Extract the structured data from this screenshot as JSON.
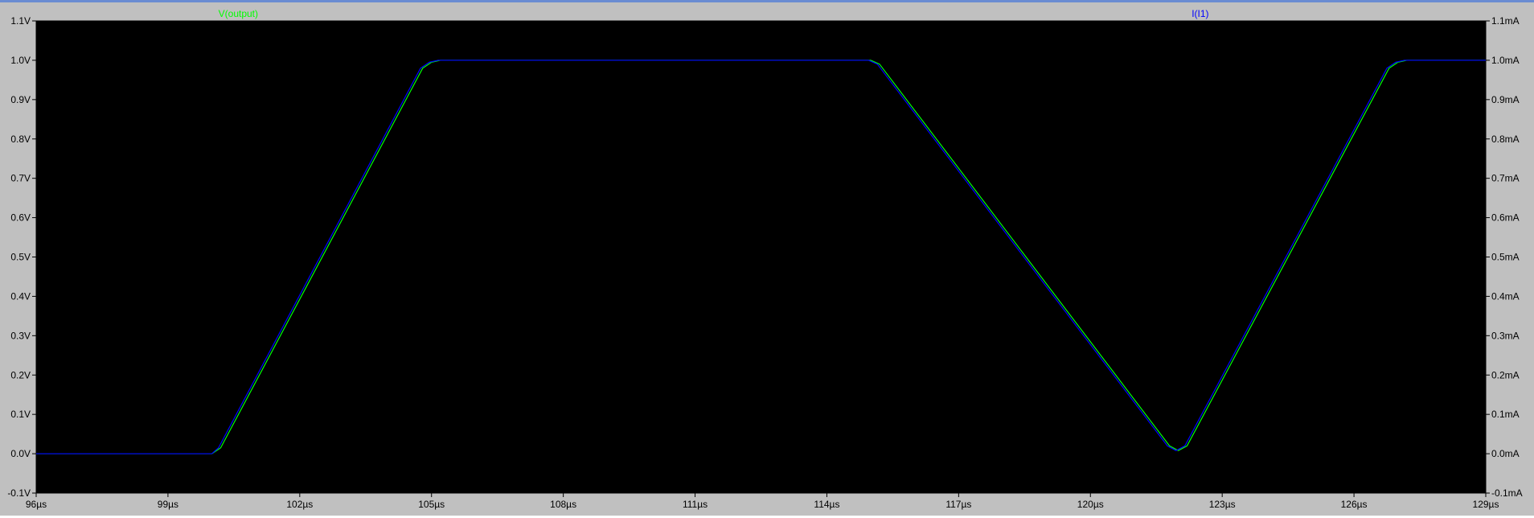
{
  "window": {
    "background": "#c0c0c0",
    "plot_background": "#000000"
  },
  "chart_data": {
    "type": "line",
    "title": "",
    "xlabel": "",
    "ylabel": "",
    "x_unit": "µs",
    "xlim": [
      96,
      129
    ],
    "ylim": [
      -0.1,
      1.1
    ],
    "y2lim": [
      -0.1,
      1.1
    ],
    "x_ticks": [
      "96µs",
      "99µs",
      "102µs",
      "105µs",
      "108µs",
      "111µs",
      "114µs",
      "117µs",
      "120µs",
      "123µs",
      "126µs",
      "129µs"
    ],
    "y_ticks_left": [
      "-0.1V",
      "0.0V",
      "0.1V",
      "0.2V",
      "0.3V",
      "0.4V",
      "0.5V",
      "0.6V",
      "0.7V",
      "0.8V",
      "0.9V",
      "1.0V",
      "1.1V"
    ],
    "y_ticks_right": [
      "-0.1mA",
      "0.0mA",
      "0.1mA",
      "0.2mA",
      "0.3mA",
      "0.4mA",
      "0.5mA",
      "0.6mA",
      "0.7mA",
      "0.8mA",
      "0.9mA",
      "1.0mA",
      "1.1mA"
    ],
    "grid": false,
    "series": [
      {
        "name": "V(output)",
        "color": "#00ff00",
        "axis": "left",
        "x": [
          96,
          100,
          100.2,
          104.8,
          105,
          105.2,
          115,
          115.2,
          121.8,
          122,
          122.2,
          126.8,
          127,
          127.2,
          129
        ],
        "y": [
          0.0,
          0.0,
          0.015,
          0.98,
          0.995,
          1.0,
          1.0,
          0.99,
          0.02,
          0.008,
          0.02,
          0.98,
          0.995,
          1.0,
          1.0
        ]
      },
      {
        "name": "I(I1)",
        "color": "#0000ff",
        "axis": "right",
        "x": [
          96,
          100,
          100.15,
          104.75,
          104.95,
          105.15,
          114.95,
          115.15,
          121.75,
          121.95,
          122.15,
          126.75,
          126.95,
          127.15,
          129
        ],
        "y": [
          0.0,
          0.0,
          0.015,
          0.98,
          0.995,
          1.0,
          1.0,
          0.99,
          0.02,
          0.008,
          0.02,
          0.98,
          0.995,
          1.0,
          1.0
        ]
      }
    ]
  }
}
